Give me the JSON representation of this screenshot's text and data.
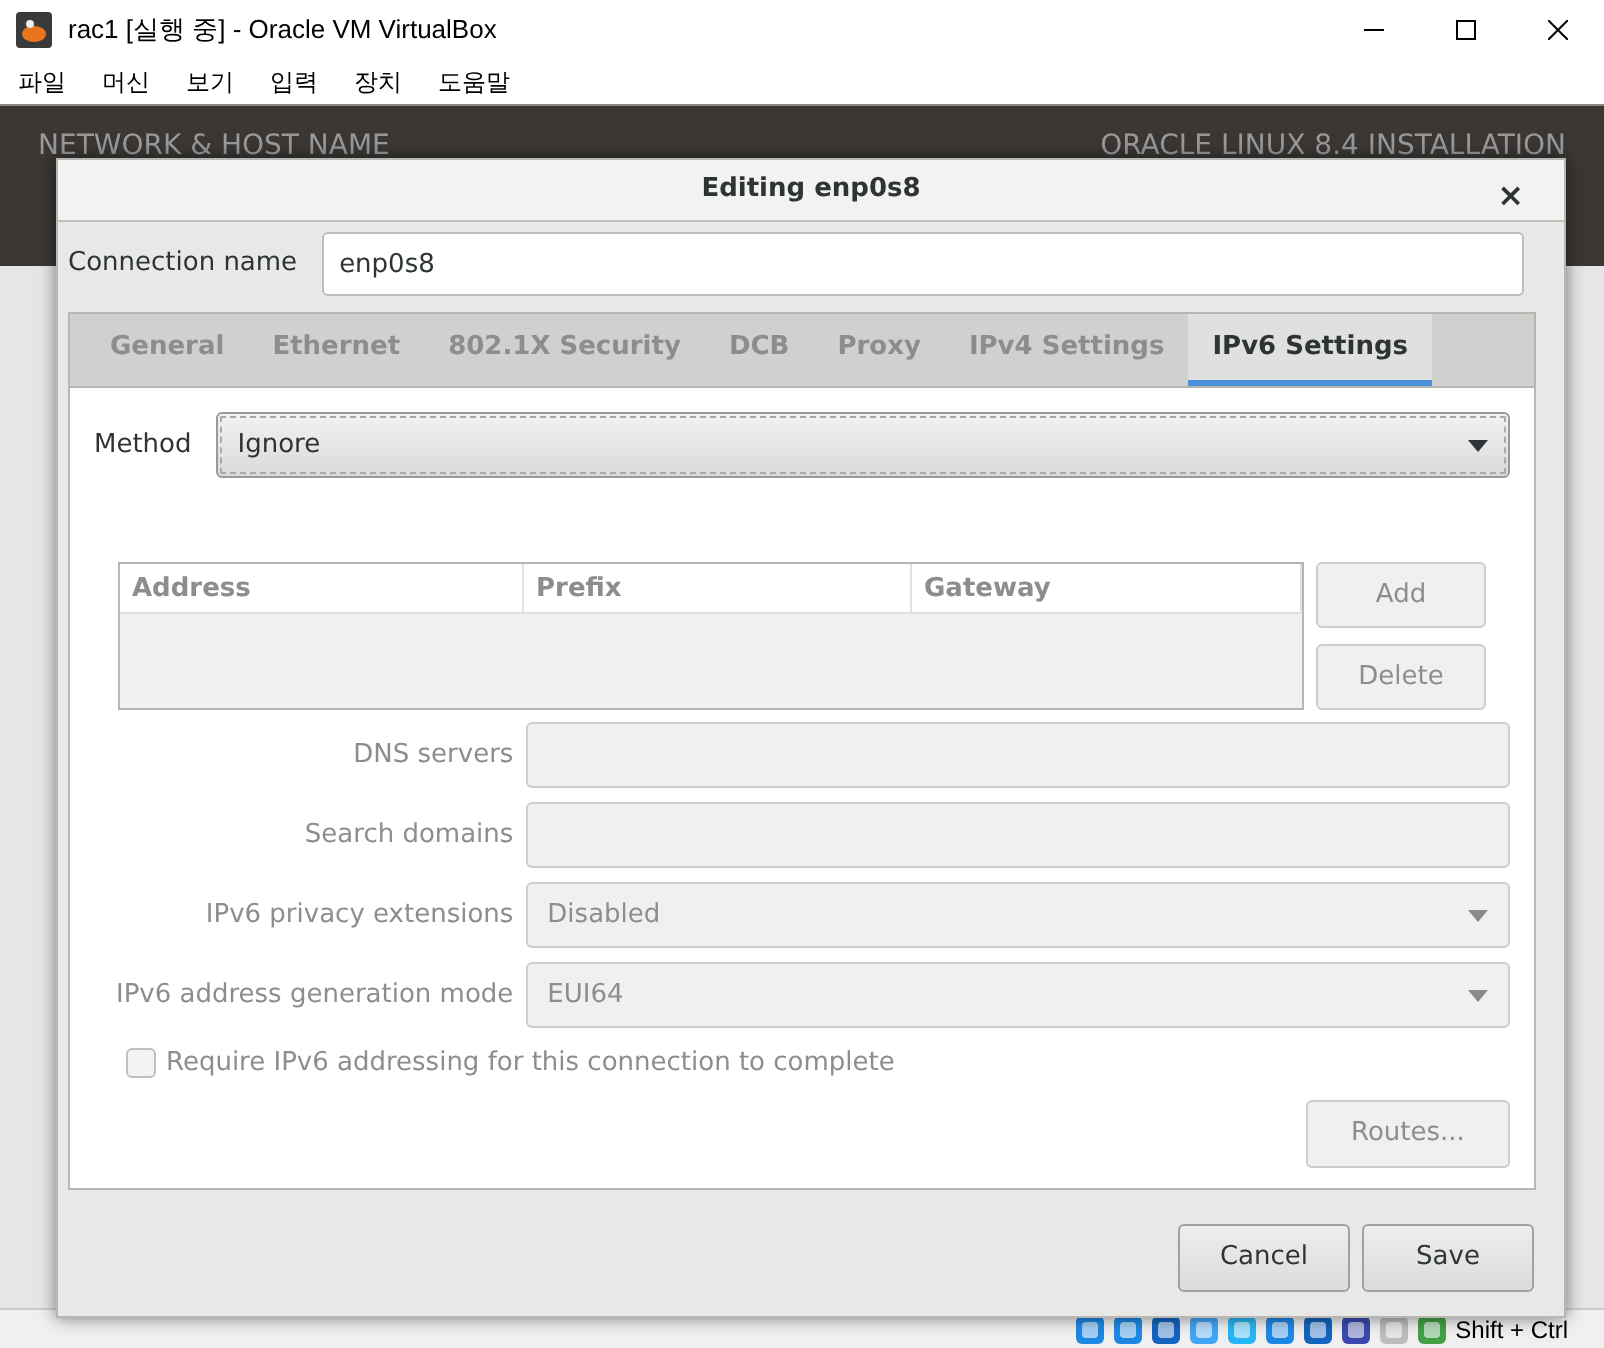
{
  "window": {
    "title": "rac1 [실행 중] - Oracle VM VirtualBox",
    "menu": [
      "파일",
      "머신",
      "보기",
      "입력",
      "장치",
      "도움말"
    ]
  },
  "guest": {
    "header_left": "NETWORK & HOST NAME",
    "header_right": "ORACLE LINUX 8.4 INSTALLATION"
  },
  "dialog": {
    "title": "Editing enp0s8",
    "close": "×",
    "connection_name": {
      "label": "Connection name",
      "value": "enp0s8"
    },
    "tabs": [
      {
        "label": "General",
        "selected": false
      },
      {
        "label": "Ethernet",
        "selected": false
      },
      {
        "label": "802.1X Security",
        "selected": false
      },
      {
        "label": "DCB",
        "selected": false
      },
      {
        "label": "Proxy",
        "selected": false
      },
      {
        "label": "IPv4 Settings",
        "selected": false
      },
      {
        "label": "IPv6 Settings",
        "selected": true
      }
    ],
    "method": {
      "label": "Method",
      "value": "Ignore"
    },
    "table": {
      "columns": [
        "Address",
        "Prefix",
        "Gateway"
      ]
    },
    "table_buttons": [
      {
        "label": "Add",
        "disabled": true
      },
      {
        "label": "Delete",
        "disabled": true
      }
    ],
    "fields": [
      {
        "label": "DNS servers",
        "kind": "text",
        "disabled": true
      },
      {
        "label": "Search domains",
        "kind": "text",
        "disabled": true
      },
      {
        "label": "IPv6 privacy extensions",
        "kind": "dropdown",
        "value": "Disabled",
        "disabled": true
      },
      {
        "label": "IPv6 address generation mode",
        "kind": "dropdown",
        "value": "EUI64",
        "disabled": true
      }
    ],
    "require": {
      "label": "Require IPv6 addressing for this connection to complete",
      "checked": false,
      "disabled": true
    },
    "routes": {
      "label": "Routes...",
      "disabled": true
    },
    "footer_buttons": [
      "Cancel",
      "Save"
    ]
  },
  "status_bar": {
    "host_key": "Shift + Ctrl"
  }
}
